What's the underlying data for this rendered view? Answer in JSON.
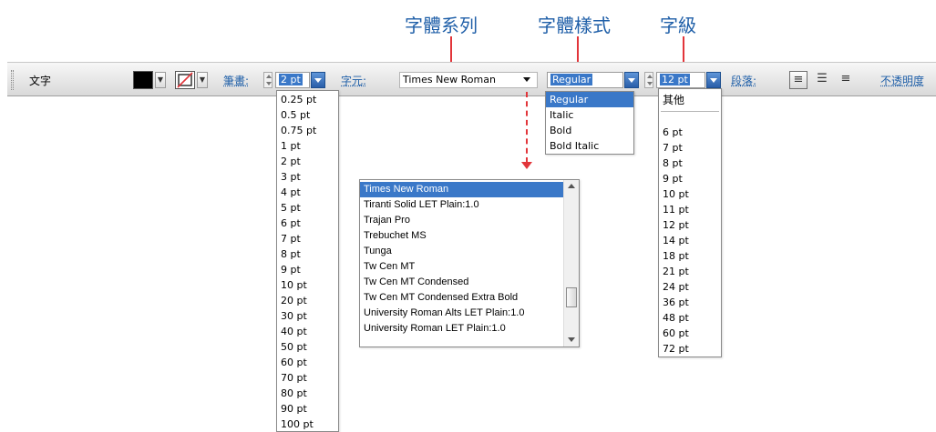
{
  "callouts": {
    "font_family": "字體系列",
    "font_style": "字體樣式",
    "font_size": "字級"
  },
  "toolbar": {
    "title": "文字",
    "stroke_label": "筆畫:",
    "stroke_value": "2 pt",
    "font_label": "字元:",
    "font_value": "Times New Roman",
    "style_value": "Regular",
    "size_value": "12 pt",
    "paragraph_label": "段落:",
    "opacity_label": "不透明度",
    "fill_color": "#000000",
    "stroke_color_none": "#e2353a"
  },
  "stroke_list": [
    "0.25 pt",
    "0.5 pt",
    "0.75 pt",
    "1 pt",
    "2 pt",
    "3 pt",
    "4 pt",
    "5 pt",
    "6 pt",
    "7 pt",
    "8 pt",
    "9 pt",
    "10 pt",
    "20 pt",
    "30 pt",
    "40 pt",
    "50 pt",
    "60 pt",
    "70 pt",
    "80 pt",
    "90 pt",
    "100 pt"
  ],
  "style_list": [
    "Regular",
    "Italic",
    "Bold",
    "Bold Italic"
  ],
  "size_list": {
    "other": "其他",
    "items": [
      "6 pt",
      "7 pt",
      "8 pt",
      "9 pt",
      "10 pt",
      "11 pt",
      "12 pt",
      "14 pt",
      "18 pt",
      "21 pt",
      "24 pt",
      "36 pt",
      "48 pt",
      "60 pt",
      "72 pt"
    ]
  },
  "font_list": [
    "Times New Roman",
    "Tiranti Solid LET Plain:1.0",
    "Trajan Pro",
    "Trebuchet MS",
    "Tunga",
    "Tw Cen MT",
    "Tw Cen MT Condensed",
    "Tw Cen MT Condensed Extra Bold",
    "University Roman Alts LET Plain:1.0",
    "University Roman LET Plain:1.0"
  ],
  "colors": {
    "accent": "#3a78c8",
    "callout_text": "#1f5fa8",
    "leader": "#e2353a"
  }
}
